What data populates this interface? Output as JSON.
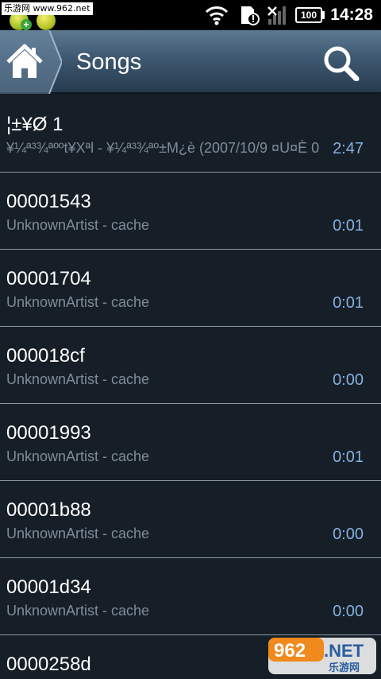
{
  "status_bar": {
    "watermark_text": "乐游网 www.962.net",
    "time": "14:28",
    "battery_label": "100",
    "icons": [
      "notification-app-icon",
      "notification-app-icon",
      "wifi-icon",
      "sd-card-alert-icon",
      "no-signal-icon",
      "battery-icon"
    ]
  },
  "header": {
    "title": "Songs",
    "home_icon": "home-icon",
    "search_icon": "search-icon"
  },
  "songs": [
    {
      "title": "¦±¥Ø 1",
      "subtitle": "¥¼ª³¾ªººt¥Xªl - ¥¼ª³¾ªº±M¿è (2007/10/9 ¤U¤È 0",
      "duration": "2:47"
    },
    {
      "title": "00001543",
      "subtitle": "UnknownArtist - cache",
      "duration": "0:01"
    },
    {
      "title": "00001704",
      "subtitle": "UnknownArtist - cache",
      "duration": "0:01"
    },
    {
      "title": "000018cf",
      "subtitle": "UnknownArtist - cache",
      "duration": "0:00"
    },
    {
      "title": "00001993",
      "subtitle": "UnknownArtist - cache",
      "duration": "0:01"
    },
    {
      "title": "00001b88",
      "subtitle": "UnknownArtist - cache",
      "duration": "0:00"
    },
    {
      "title": "00001d34",
      "subtitle": "UnknownArtist - cache",
      "duration": "0:00"
    },
    {
      "title": "0000258d",
      "subtitle": "",
      "duration": ""
    }
  ],
  "watermark_badge": {
    "number": "962",
    "suffix": ".NET",
    "caption": "乐游网"
  },
  "colors": {
    "background": "#161e27",
    "header_top": "#5d7891",
    "header_bottom": "#273b4e",
    "title_text": "#ffffff",
    "subtitle_text": "#7f8c99",
    "duration_text": "#86b1dd",
    "divider": "#8d99a6"
  }
}
